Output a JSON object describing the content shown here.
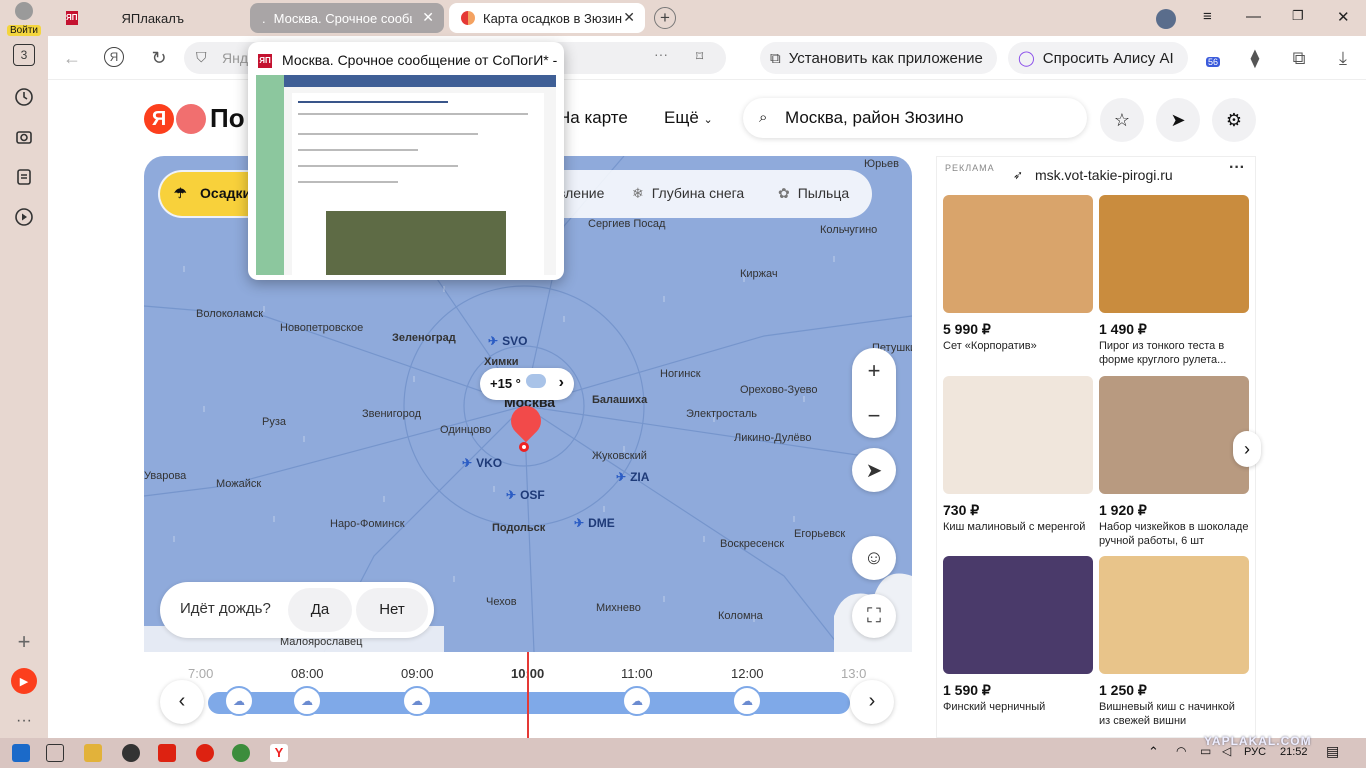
{
  "rail": {
    "login_label": "Войти",
    "badge": "3"
  },
  "tabs": [
    {
      "title": "ЯПлакалъ"
    },
    {
      "title": "Москва. Срочное сообщ"
    },
    {
      "title": "Карта осадков в Зюзин"
    }
  ],
  "toolbar": {
    "address_text": "Янде",
    "install_label": "Установить как приложение",
    "alice_label": "Спросить Алису AI",
    "ext_badge": "56"
  },
  "tab_preview": {
    "title": "Москва. Срочное сообщение от СоПогИ* - Я..."
  },
  "header": {
    "logo_letter": "Я",
    "logo_text": "По",
    "nav_map": "На карте",
    "nav_more": "Ещё",
    "search_value": "Москва, район Зюзино"
  },
  "map": {
    "layers": {
      "active": "Осадки",
      "item2": "вление",
      "item3": "Глубина снега",
      "item4": "Пыльца"
    },
    "cities": [
      {
        "name": "Сергиев Посад"
      },
      {
        "name": "Юрьев"
      },
      {
        "name": "Кольчугино"
      },
      {
        "name": "Киржач"
      },
      {
        "name": "Волоколамск"
      },
      {
        "name": "Новопетровское"
      },
      {
        "name": "Зеленоград"
      },
      {
        "name": "Химки"
      },
      {
        "name": "Ногинск"
      },
      {
        "name": "Орехово-Зуево"
      },
      {
        "name": "Петушки"
      },
      {
        "name": "Руза"
      },
      {
        "name": "Звенигород"
      },
      {
        "name": "Одинцово"
      },
      {
        "name": "Москва"
      },
      {
        "name": "Балашиха"
      },
      {
        "name": "Электросталь"
      },
      {
        "name": "Ликино-Дулёво"
      },
      {
        "name": "Жуковский"
      },
      {
        "name": "Уварова"
      },
      {
        "name": "Можайск"
      },
      {
        "name": "Наро-Фоминск"
      },
      {
        "name": "Подольск"
      },
      {
        "name": "Егорьевск"
      },
      {
        "name": "Воскресенск"
      },
      {
        "name": "Чехов"
      },
      {
        "name": "Михнево"
      },
      {
        "name": "Коломна"
      },
      {
        "name": "Малоярославец"
      }
    ],
    "airports": [
      {
        "code": "SVO"
      },
      {
        "code": "VKO"
      },
      {
        "code": "OSF"
      },
      {
        "code": "ZIA"
      },
      {
        "code": "DME"
      }
    ],
    "temperature": "+15 °",
    "rain_question": "Идёт дождь?",
    "rain_yes": "Да",
    "rain_no": "Нет"
  },
  "timeline": {
    "times": [
      "7:00",
      "08:00",
      "09:00",
      "10:00",
      "11:00",
      "12:00",
      "13:0"
    ]
  },
  "ads": {
    "label": "РЕКЛАМА",
    "domain": "msk.vot-takie-pirogi.ru",
    "items": [
      {
        "price": "5 990 ₽",
        "name": "Сет «Корпоратив»",
        "color": "#d9a46b"
      },
      {
        "price": "1 490 ₽",
        "name": "Пирог из тонкого теста в форме круглого рулета...",
        "color": "#c98c3e"
      },
      {
        "price": "730 ₽",
        "name": "Киш малиновый с меренгой",
        "color": "#f0e6dc"
      },
      {
        "price": "1 920 ₽",
        "name": "Набор чизкейков в шоколаде ручной работы, 6 шт",
        "color": "#b89a80"
      },
      {
        "price": "1 590 ₽",
        "name": "Финский черничный",
        "color": "#4a3a6a"
      },
      {
        "price": "1 250 ₽",
        "name": "Вишневый киш с начинкой из свежей вишни",
        "color": "#e8c48a"
      }
    ]
  },
  "taskbar": {
    "lang": "РУС",
    "time": "21:52"
  },
  "watermark": "YAPLAKAL.COM"
}
